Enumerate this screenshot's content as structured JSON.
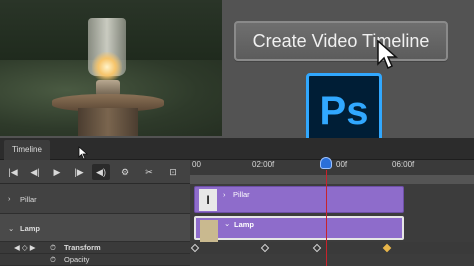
{
  "window": {
    "title": "Create Video Timeline"
  },
  "create_button": {
    "label": "Create Video Timeline"
  },
  "app_logo": {
    "text": "Ps"
  },
  "panel": {
    "tab_label": "Timeline",
    "controls": [
      "|◀",
      "◀|",
      "▶",
      "|▶",
      "◀)",
      "⚙",
      "✂",
      "⊡"
    ],
    "ruler": {
      "labels": [
        "00",
        "02:00f",
        "00f",
        "06:00f"
      ]
    },
    "layers": [
      {
        "name": "Pillar",
        "clip_label": "Pillar"
      },
      {
        "name": "Lamp",
        "clip_label": "Lamp"
      }
    ],
    "properties": [
      "Transform",
      "Opacity"
    ]
  },
  "colors": {
    "clip_purple": "#8e6ccb",
    "playhead_red": "#c8232b",
    "ps_blue": "#31a8ff",
    "ps_bg": "#001e36"
  }
}
